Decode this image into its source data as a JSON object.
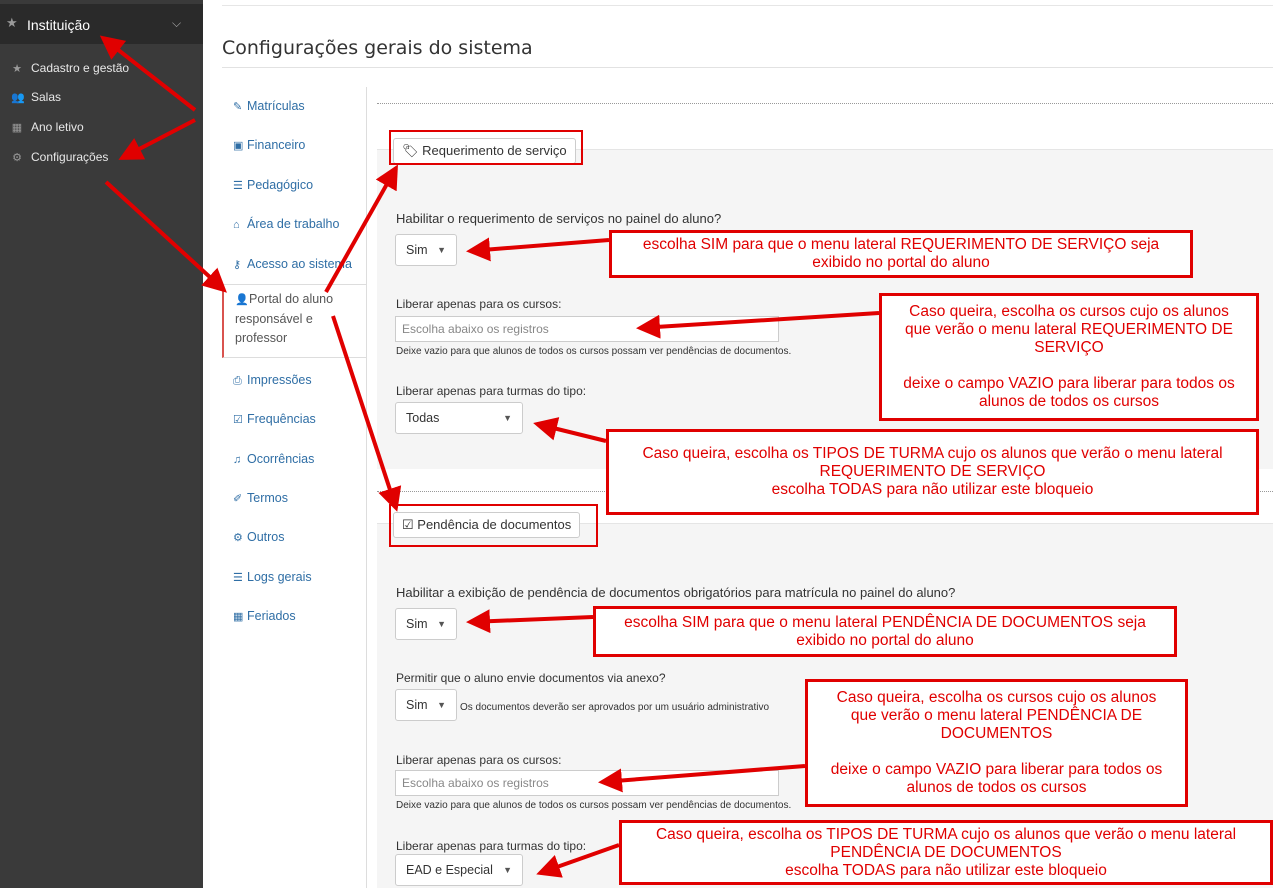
{
  "sidebar": {
    "header": {
      "icon": "star-icon",
      "title": "Instituição",
      "chevron": "chevron-down-icon"
    },
    "items": [
      {
        "icon": "star-icon",
        "label": "Cadastro e gestão"
      },
      {
        "icon": "users-icon",
        "label": "Salas"
      },
      {
        "icon": "calendar-icon",
        "label": "Ano letivo"
      },
      {
        "icon": "gears-icon",
        "label": "Configurações"
      }
    ]
  },
  "page": {
    "title": "Configurações gerais do sistema"
  },
  "settings_nav": [
    {
      "icon": "edit-icon",
      "label": "Matrículas"
    },
    {
      "icon": "money-icon",
      "label": "Financeiro"
    },
    {
      "icon": "list-icon",
      "label": "Pedagógico"
    },
    {
      "icon": "home-icon",
      "label": "Área de trabalho"
    },
    {
      "icon": "key-icon",
      "label": "Acesso ao sistema"
    },
    {
      "icon": "user-icon",
      "label": "Portal do aluno responsável e professor"
    },
    {
      "icon": "print-icon",
      "label": "Impressões"
    },
    {
      "icon": "check-square-icon",
      "label": "Frequências"
    },
    {
      "icon": "bell-icon",
      "label": "Ocorrências"
    },
    {
      "icon": "pencil-icon",
      "label": "Termos"
    },
    {
      "icon": "gears-icon",
      "label": "Outros"
    },
    {
      "icon": "list-icon",
      "label": "Logs gerais"
    },
    {
      "icon": "calendar-icon",
      "label": "Feriados"
    }
  ],
  "requerimento": {
    "legend_icon": "tag-icon",
    "legend": "Requerimento de serviço",
    "q_enable": "Habilitar o requerimento de serviços no painel do aluno?",
    "enable_value": "Sim",
    "courses_label": "Liberar apenas para os cursos:",
    "courses_placeholder": "Escolha abaixo os registros",
    "courses_hint": "Deixe vazio para que alunos de todos os cursos possam ver pendências de documentos.",
    "types_label": "Liberar apenas para turmas do tipo:",
    "types_value": "Todas"
  },
  "pendencia": {
    "legend_icon": "check-square-icon",
    "legend": "Pendência de documentos",
    "q_enable": "Habilitar a exibição de pendência de documentos obrigatórios para matrícula no painel do aluno?",
    "enable_value": "Sim",
    "attach_label": "Permitir que o aluno envie documentos via anexo?",
    "attach_value": "Sim",
    "attach_hint": "Os documentos deverão ser aprovados por um usuário administrativo",
    "courses_label": "Liberar apenas para os cursos:",
    "courses_placeholder": "Escolha abaixo os registros",
    "courses_hint": "Deixe vazio para que alunos de todos os cursos possam ver pendências de documentos.",
    "types_label": "Liberar apenas para turmas do tipo:",
    "types_value": "EAD e Especial"
  },
  "callouts": {
    "req_enable": [
      "escolha SIM para que o menu lateral REQUERIMENTO DE SERVIÇO seja",
      "exibido no portal do aluno"
    ],
    "req_courses": [
      "Caso queira, escolha os cursos cujo os alunos",
      "que verão o menu lateral REQUERIMENTO DE",
      "SERVIÇO",
      "deixe o campo VAZIO para liberar para todos os",
      "alunos de todos os cursos"
    ],
    "req_types": [
      "Caso queira, escolha os TIPOS DE TURMA cujo os alunos que verão o menu lateral",
      "REQUERIMENTO DE SERVIÇO",
      "escolha TODAS para não utilizar este bloqueio"
    ],
    "pend_enable": [
      "escolha SIM para que o menu lateral PENDÊNCIA DE DOCUMENTOS seja",
      "exibido no portal do aluno"
    ],
    "pend_courses": [
      "Caso queira, escolha os cursos cujo os alunos",
      "que verão o menu lateral PENDÊNCIA DE",
      "DOCUMENTOS",
      "deixe o campo VAZIO para liberar para todos os",
      "alunos de todos os cursos"
    ],
    "pend_types": [
      "Caso queira, escolha os TIPOS DE TURMA cujo os alunos que verão o menu lateral",
      "PENDÊNCIA DE DOCUMENTOS",
      "escolha TODAS para não utilizar este bloqueio"
    ]
  },
  "colors": {
    "annotation_red": "#e00000",
    "sidebar_bg": "#3a3a3a",
    "link_blue": "#2f6ea5"
  }
}
